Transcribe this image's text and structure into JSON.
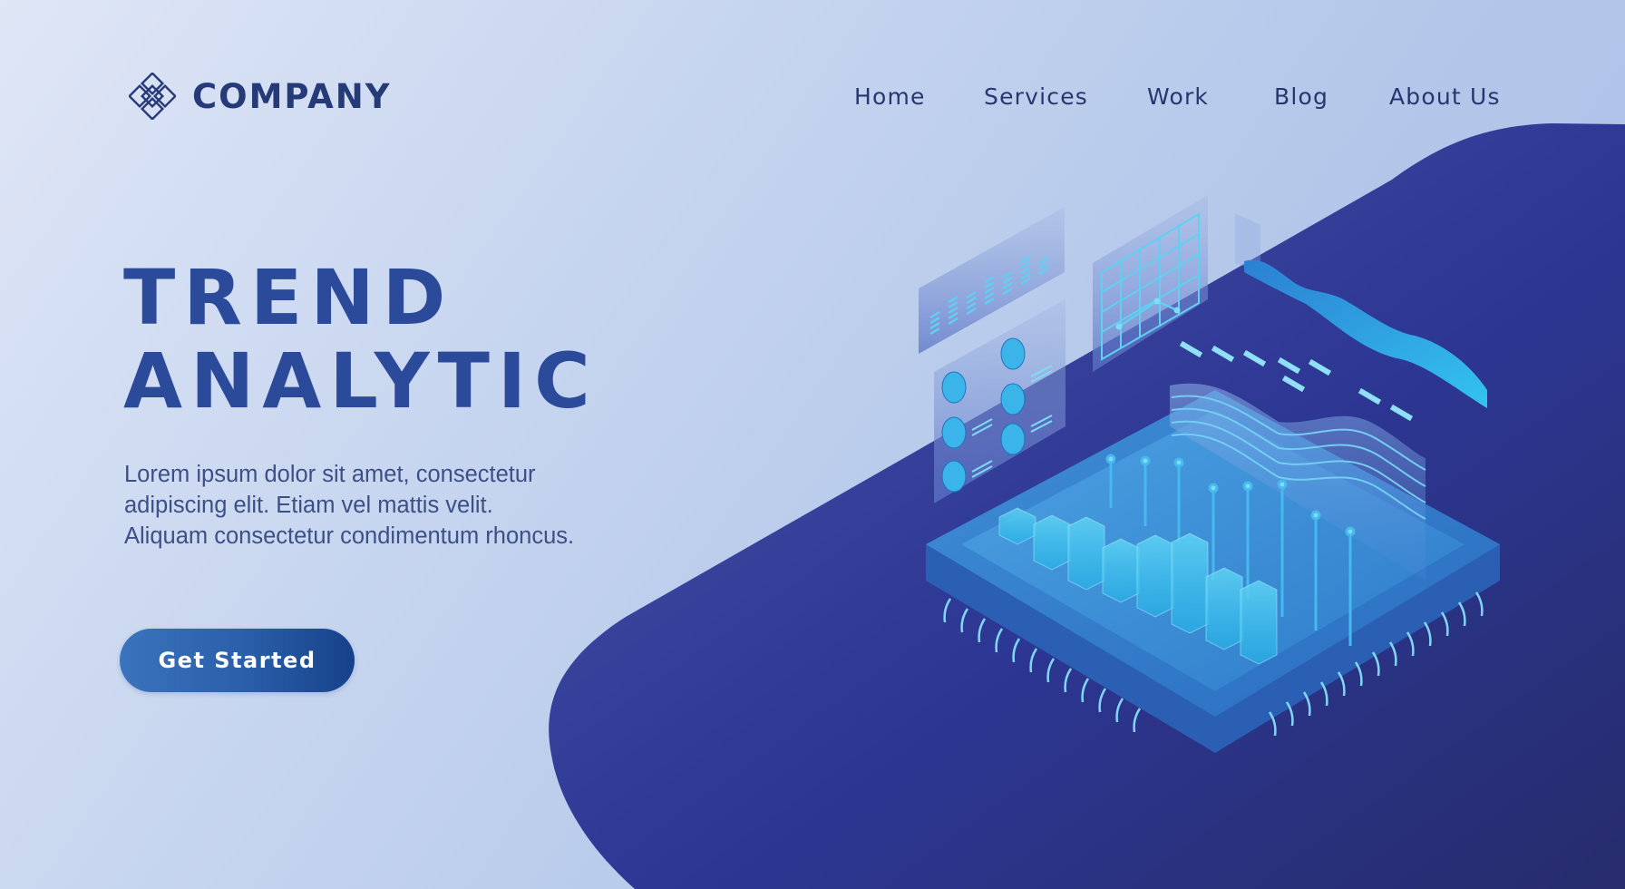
{
  "brand": {
    "name": "COMPANY",
    "logo_icon": "interlocking-diamonds-knot-icon"
  },
  "nav": {
    "items": [
      {
        "label": "Home"
      },
      {
        "label": "Services"
      },
      {
        "label": "Work"
      },
      {
        "label": "Blog"
      },
      {
        "label": "About Us"
      }
    ]
  },
  "hero": {
    "title_line1": "TREND",
    "title_line2": "ANALYTIC",
    "description_lines": [
      "Lorem ipsum dolor sit amet, consectetur",
      "adipiscing elit. Etiam vel mattis velit.",
      "Aliquam consectetur condimentum rhoncus."
    ],
    "cta_label": "Get Started"
  },
  "illustration": {
    "subject": "isometric-trend-analytics-dashboard-on-chip",
    "elements": [
      "bar-meter-panel",
      "pie-charts-panel",
      "grid-line-chart-panel",
      "wave-area-chart-panel",
      "layered-wave-chart",
      "isometric-bar-chart",
      "processor-chip-base"
    ]
  },
  "colors": {
    "background_light": "#dfe6f6",
    "background_mid": "#b3c7ea",
    "blob_dark": "#2c3590",
    "blob_light": "#4450a2",
    "title_blue": "#2c4a9a",
    "text_navy": "#263a78",
    "cta_start": "#3b73bd",
    "cta_end": "#16418a",
    "accent_cyan": "#29c6f0"
  }
}
